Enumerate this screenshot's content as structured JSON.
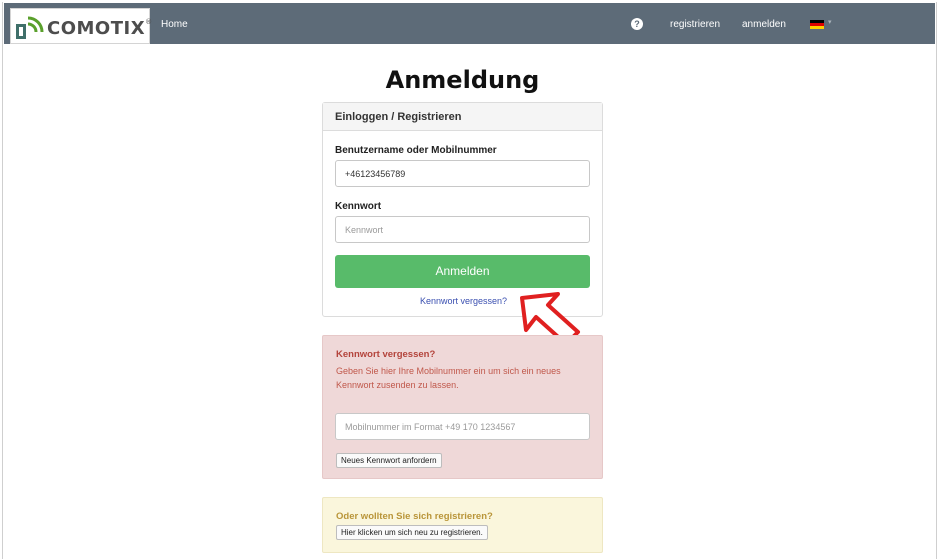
{
  "navbar": {
    "brand": "COMOTIX",
    "brand_reg": "®",
    "home": "Home",
    "help_glyph": "?",
    "register": "registrieren",
    "login": "anmelden",
    "language_flag": "de-flag-icon",
    "caret": "▾"
  },
  "page": {
    "title": "Anmeldung"
  },
  "login_panel": {
    "heading": "Einloggen / Registrieren",
    "username_label": "Benutzername oder Mobilnummer",
    "username_value": "+46123456789",
    "password_label": "Kennwort",
    "password_placeholder": "Kennwort",
    "submit_label": "Anmelden",
    "forgot_link": "Kennwort vergessen?"
  },
  "forgot_panel": {
    "title": "Kennwort vergessen?",
    "text": "Geben Sie hier Ihre Mobilnummer ein um sich ein neues Kennwort zusenden zu lassen.",
    "phone_placeholder": "Mobilnummer im Format +49 170 1234567",
    "request_button": "Neues Kennwort anfordern"
  },
  "register_panel": {
    "title": "Oder wollten Sie sich registrieren?",
    "button": "Hier klicken um sich neu zu registrieren."
  },
  "colors": {
    "navbar": "#5d6b78",
    "primary_button": "#58bb6a",
    "danger_bg": "#efd8d8",
    "danger_text": "#b4443c",
    "warning_bg": "#faf6dc",
    "warning_text": "#b99539",
    "annotation_arrow": "#e02020"
  }
}
